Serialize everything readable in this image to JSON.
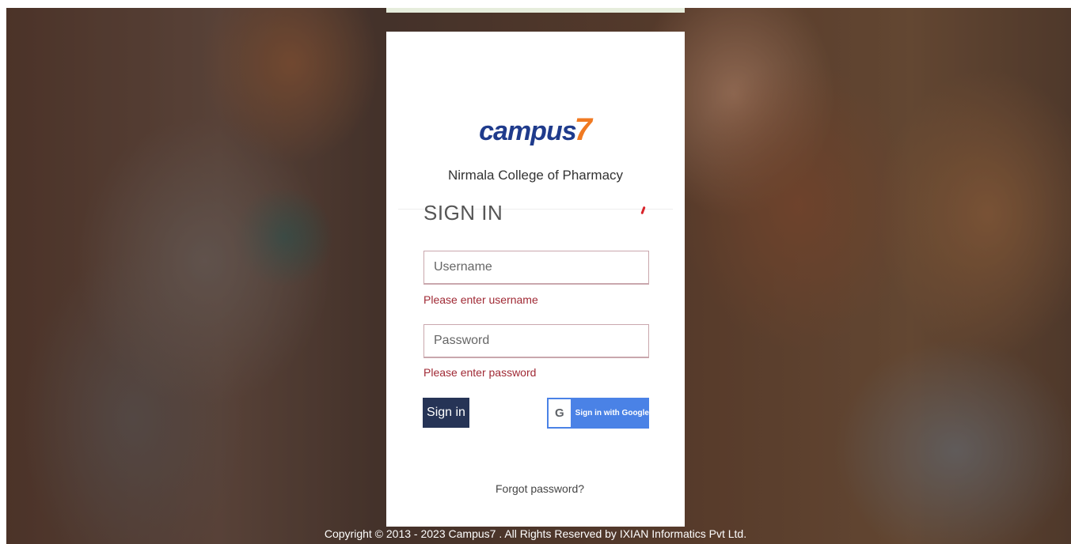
{
  "brand": {
    "logo_text": "campus",
    "logo_digit": "7",
    "college_name": "Nirmala College of Pharmacy",
    "logo_colors": {
      "text": "#1f3b8c",
      "digit": "#f07a22"
    }
  },
  "signin": {
    "title": "SIGN IN",
    "username": {
      "placeholder": "Username",
      "value": "",
      "error": "Please enter username"
    },
    "password": {
      "placeholder": "Password",
      "value": "",
      "error": "Please enter password"
    },
    "submit_label": "Sign in",
    "google": {
      "icon_letter": "G",
      "label": "Sign in with Google"
    },
    "forgot_label": "Forgot password?"
  },
  "footer": {
    "copyright": "Copyright © 2013 - 2023 Campus7 . All Rights Reserved by IXIAN Informatics Pvt Ltd."
  },
  "colors": {
    "primary_button": "#263456",
    "google_button": "#4a82e6",
    "error_text": "#a02a35"
  }
}
